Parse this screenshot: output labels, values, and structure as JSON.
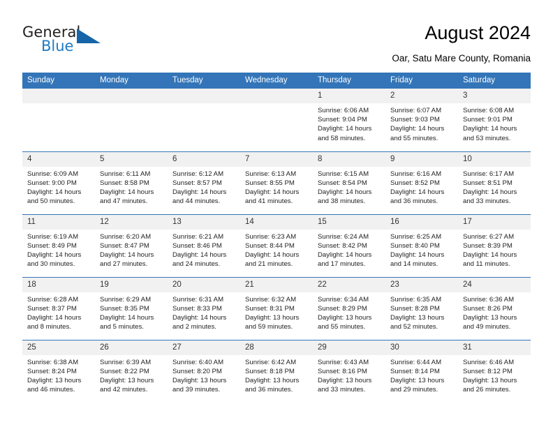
{
  "brand": {
    "name_part1": "General",
    "name_part2": "Blue",
    "triangle_icon": "triangle-logo-icon",
    "accent_color": "#1565a8",
    "blue_text_color": "#1f7bc4"
  },
  "header": {
    "title": "August 2024",
    "subtitle": "Oar, Satu Mare County, Romania"
  },
  "calendar": {
    "header_bg": "#3375b8",
    "daynum_bg": "#f1f1f1",
    "weekday_headers": [
      "Sunday",
      "Monday",
      "Tuesday",
      "Wednesday",
      "Thursday",
      "Friday",
      "Saturday"
    ],
    "weeks": [
      [
        {
          "day": "",
          "empty": true,
          "sunrise": "",
          "sunset": "",
          "daylight1": "",
          "daylight2": ""
        },
        {
          "day": "",
          "empty": true,
          "sunrise": "",
          "sunset": "",
          "daylight1": "",
          "daylight2": ""
        },
        {
          "day": "",
          "empty": true,
          "sunrise": "",
          "sunset": "",
          "daylight1": "",
          "daylight2": ""
        },
        {
          "day": "",
          "empty": true,
          "sunrise": "",
          "sunset": "",
          "daylight1": "",
          "daylight2": ""
        },
        {
          "day": "1",
          "empty": false,
          "sunrise": "Sunrise: 6:06 AM",
          "sunset": "Sunset: 9:04 PM",
          "daylight1": "Daylight: 14 hours",
          "daylight2": "and 58 minutes."
        },
        {
          "day": "2",
          "empty": false,
          "sunrise": "Sunrise: 6:07 AM",
          "sunset": "Sunset: 9:03 PM",
          "daylight1": "Daylight: 14 hours",
          "daylight2": "and 55 minutes."
        },
        {
          "day": "3",
          "empty": false,
          "sunrise": "Sunrise: 6:08 AM",
          "sunset": "Sunset: 9:01 PM",
          "daylight1": "Daylight: 14 hours",
          "daylight2": "and 53 minutes."
        }
      ],
      [
        {
          "day": "4",
          "empty": false,
          "sunrise": "Sunrise: 6:09 AM",
          "sunset": "Sunset: 9:00 PM",
          "daylight1": "Daylight: 14 hours",
          "daylight2": "and 50 minutes."
        },
        {
          "day": "5",
          "empty": false,
          "sunrise": "Sunrise: 6:11 AM",
          "sunset": "Sunset: 8:58 PM",
          "daylight1": "Daylight: 14 hours",
          "daylight2": "and 47 minutes."
        },
        {
          "day": "6",
          "empty": false,
          "sunrise": "Sunrise: 6:12 AM",
          "sunset": "Sunset: 8:57 PM",
          "daylight1": "Daylight: 14 hours",
          "daylight2": "and 44 minutes."
        },
        {
          "day": "7",
          "empty": false,
          "sunrise": "Sunrise: 6:13 AM",
          "sunset": "Sunset: 8:55 PM",
          "daylight1": "Daylight: 14 hours",
          "daylight2": "and 41 minutes."
        },
        {
          "day": "8",
          "empty": false,
          "sunrise": "Sunrise: 6:15 AM",
          "sunset": "Sunset: 8:54 PM",
          "daylight1": "Daylight: 14 hours",
          "daylight2": "and 38 minutes."
        },
        {
          "day": "9",
          "empty": false,
          "sunrise": "Sunrise: 6:16 AM",
          "sunset": "Sunset: 8:52 PM",
          "daylight1": "Daylight: 14 hours",
          "daylight2": "and 36 minutes."
        },
        {
          "day": "10",
          "empty": false,
          "sunrise": "Sunrise: 6:17 AM",
          "sunset": "Sunset: 8:51 PM",
          "daylight1": "Daylight: 14 hours",
          "daylight2": "and 33 minutes."
        }
      ],
      [
        {
          "day": "11",
          "empty": false,
          "sunrise": "Sunrise: 6:19 AM",
          "sunset": "Sunset: 8:49 PM",
          "daylight1": "Daylight: 14 hours",
          "daylight2": "and 30 minutes."
        },
        {
          "day": "12",
          "empty": false,
          "sunrise": "Sunrise: 6:20 AM",
          "sunset": "Sunset: 8:47 PM",
          "daylight1": "Daylight: 14 hours",
          "daylight2": "and 27 minutes."
        },
        {
          "day": "13",
          "empty": false,
          "sunrise": "Sunrise: 6:21 AM",
          "sunset": "Sunset: 8:46 PM",
          "daylight1": "Daylight: 14 hours",
          "daylight2": "and 24 minutes."
        },
        {
          "day": "14",
          "empty": false,
          "sunrise": "Sunrise: 6:23 AM",
          "sunset": "Sunset: 8:44 PM",
          "daylight1": "Daylight: 14 hours",
          "daylight2": "and 21 minutes."
        },
        {
          "day": "15",
          "empty": false,
          "sunrise": "Sunrise: 6:24 AM",
          "sunset": "Sunset: 8:42 PM",
          "daylight1": "Daylight: 14 hours",
          "daylight2": "and 17 minutes."
        },
        {
          "day": "16",
          "empty": false,
          "sunrise": "Sunrise: 6:25 AM",
          "sunset": "Sunset: 8:40 PM",
          "daylight1": "Daylight: 14 hours",
          "daylight2": "and 14 minutes."
        },
        {
          "day": "17",
          "empty": false,
          "sunrise": "Sunrise: 6:27 AM",
          "sunset": "Sunset: 8:39 PM",
          "daylight1": "Daylight: 14 hours",
          "daylight2": "and 11 minutes."
        }
      ],
      [
        {
          "day": "18",
          "empty": false,
          "sunrise": "Sunrise: 6:28 AM",
          "sunset": "Sunset: 8:37 PM",
          "daylight1": "Daylight: 14 hours",
          "daylight2": "and 8 minutes."
        },
        {
          "day": "19",
          "empty": false,
          "sunrise": "Sunrise: 6:29 AM",
          "sunset": "Sunset: 8:35 PM",
          "daylight1": "Daylight: 14 hours",
          "daylight2": "and 5 minutes."
        },
        {
          "day": "20",
          "empty": false,
          "sunrise": "Sunrise: 6:31 AM",
          "sunset": "Sunset: 8:33 PM",
          "daylight1": "Daylight: 14 hours",
          "daylight2": "and 2 minutes."
        },
        {
          "day": "21",
          "empty": false,
          "sunrise": "Sunrise: 6:32 AM",
          "sunset": "Sunset: 8:31 PM",
          "daylight1": "Daylight: 13 hours",
          "daylight2": "and 59 minutes."
        },
        {
          "day": "22",
          "empty": false,
          "sunrise": "Sunrise: 6:34 AM",
          "sunset": "Sunset: 8:29 PM",
          "daylight1": "Daylight: 13 hours",
          "daylight2": "and 55 minutes."
        },
        {
          "day": "23",
          "empty": false,
          "sunrise": "Sunrise: 6:35 AM",
          "sunset": "Sunset: 8:28 PM",
          "daylight1": "Daylight: 13 hours",
          "daylight2": "and 52 minutes."
        },
        {
          "day": "24",
          "empty": false,
          "sunrise": "Sunrise: 6:36 AM",
          "sunset": "Sunset: 8:26 PM",
          "daylight1": "Daylight: 13 hours",
          "daylight2": "and 49 minutes."
        }
      ],
      [
        {
          "day": "25",
          "empty": false,
          "sunrise": "Sunrise: 6:38 AM",
          "sunset": "Sunset: 8:24 PM",
          "daylight1": "Daylight: 13 hours",
          "daylight2": "and 46 minutes."
        },
        {
          "day": "26",
          "empty": false,
          "sunrise": "Sunrise: 6:39 AM",
          "sunset": "Sunset: 8:22 PM",
          "daylight1": "Daylight: 13 hours",
          "daylight2": "and 42 minutes."
        },
        {
          "day": "27",
          "empty": false,
          "sunrise": "Sunrise: 6:40 AM",
          "sunset": "Sunset: 8:20 PM",
          "daylight1": "Daylight: 13 hours",
          "daylight2": "and 39 minutes."
        },
        {
          "day": "28",
          "empty": false,
          "sunrise": "Sunrise: 6:42 AM",
          "sunset": "Sunset: 8:18 PM",
          "daylight1": "Daylight: 13 hours",
          "daylight2": "and 36 minutes."
        },
        {
          "day": "29",
          "empty": false,
          "sunrise": "Sunrise: 6:43 AM",
          "sunset": "Sunset: 8:16 PM",
          "daylight1": "Daylight: 13 hours",
          "daylight2": "and 33 minutes."
        },
        {
          "day": "30",
          "empty": false,
          "sunrise": "Sunrise: 6:44 AM",
          "sunset": "Sunset: 8:14 PM",
          "daylight1": "Daylight: 13 hours",
          "daylight2": "and 29 minutes."
        },
        {
          "day": "31",
          "empty": false,
          "sunrise": "Sunrise: 6:46 AM",
          "sunset": "Sunset: 8:12 PM",
          "daylight1": "Daylight: 13 hours",
          "daylight2": "and 26 minutes."
        }
      ]
    ]
  }
}
